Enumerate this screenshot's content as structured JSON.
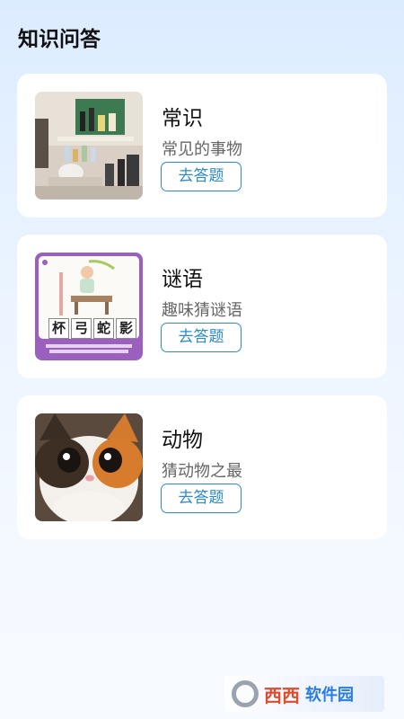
{
  "page": {
    "title": "知识问答"
  },
  "cards": [
    {
      "title": "常识",
      "subtitle": "常见的事物",
      "button": "去答题",
      "image_icon": "shelf-photo"
    },
    {
      "title": "谜语",
      "subtitle": "趣味猜谜语",
      "button": "去答题",
      "image_icon": "idiom-illustration",
      "idiom_chars": [
        "杯",
        "弓",
        "蛇",
        "影"
      ]
    },
    {
      "title": "动物",
      "subtitle": "猜动物之最",
      "button": "去答题",
      "image_icon": "cat-photo"
    }
  ],
  "watermark": {
    "brand": "西西",
    "brand2": "软件园"
  }
}
